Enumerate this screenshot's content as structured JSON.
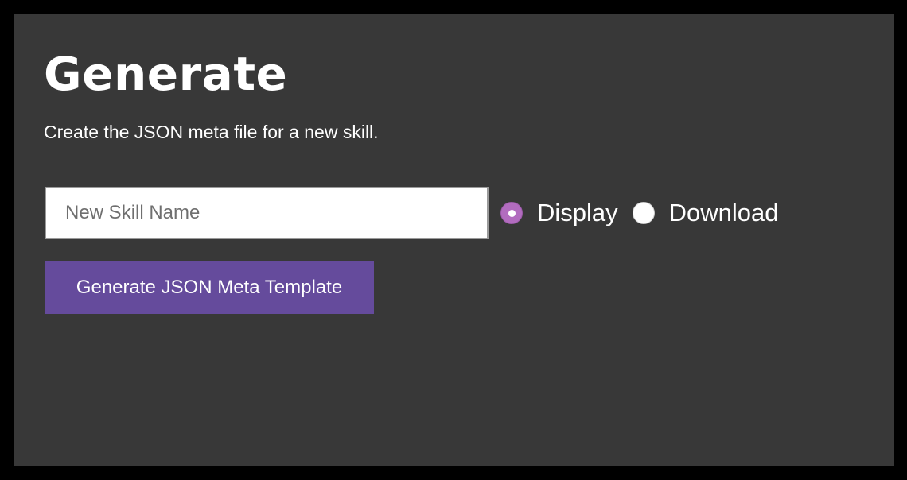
{
  "page": {
    "title": "Generate",
    "subtitle": "Create the JSON meta file for a new skill."
  },
  "form": {
    "skill_name": {
      "value": "",
      "placeholder": "New Skill Name"
    },
    "output_mode": {
      "options": [
        {
          "label": "Display",
          "checked": true
        },
        {
          "label": "Download",
          "checked": false
        }
      ]
    },
    "submit_label": "Generate JSON Meta Template"
  },
  "colors": {
    "background": "#383838",
    "accent_radio": "#b26cbf",
    "button": "#654b9c"
  }
}
